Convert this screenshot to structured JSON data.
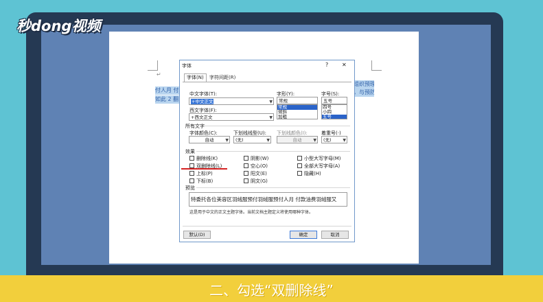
{
  "logo": {
    "text": "秒dong视频"
  },
  "caption": "二、勾选“双删除线”",
  "document": {
    "return_mark": "↵",
    "left_line1": "付人月 付",
    "left_line2": "如此 2 翻",
    "right_line1": "组织预理",
    "right_line2": "，与预防"
  },
  "dialog": {
    "title": "字体",
    "help": "?",
    "close": "✕",
    "tabs": [
      {
        "label": "字体(N)"
      },
      {
        "label": "字符间距(R)"
      }
    ],
    "chinese_font": {
      "label": "中文字体(T):",
      "value": "+中文正文"
    },
    "western_font": {
      "label": "西文字体(F):",
      "value": "+西文正文"
    },
    "style": {
      "label": "字形(Y):",
      "value": "常规",
      "options": [
        "常规",
        "倾斜",
        "加粗"
      ]
    },
    "size": {
      "label": "字号(S):",
      "value": "五号",
      "options": [
        "四号",
        "小四",
        "五号"
      ]
    },
    "all_text": {
      "heading": "所有文字",
      "font_color": {
        "label": "字体颜色(C):",
        "value": "自动"
      },
      "underline_type": {
        "label": "下划线线型(U):",
        "value": "(无)"
      },
      "underline_color": {
        "label": "下划线颜色(I):",
        "value": "自动"
      },
      "emphasis": {
        "label": "着重号(·)",
        "value": "(无)"
      }
    },
    "effects": {
      "heading": "效果",
      "col1": [
        "删除线(K)",
        "双删除线(L)",
        "上标(P)",
        "下标(B)"
      ],
      "col2": [
        "阴影(W)",
        "空心(O)",
        "阳文(E)",
        "阴文(G)"
      ],
      "col3": [
        "小型大写字母(M)",
        "全部大写字母(A)",
        "隐藏(H)"
      ]
    },
    "preview": {
      "heading": "预览",
      "sample": "特委托各位美容区羽绒服预付羽绒服预付人月 付款油费羽绒服又",
      "note": "这是用于中文的正文主题字体。当前文档主题定义将使用哪种字体。"
    },
    "buttons": {
      "default": "默认(D)",
      "ok": "确定",
      "cancel": "取消"
    }
  },
  "colors": {
    "background": "#5ec3d3",
    "frame": "#253953",
    "banner": "#f2cf3c",
    "underline_mark": "#d42020"
  }
}
